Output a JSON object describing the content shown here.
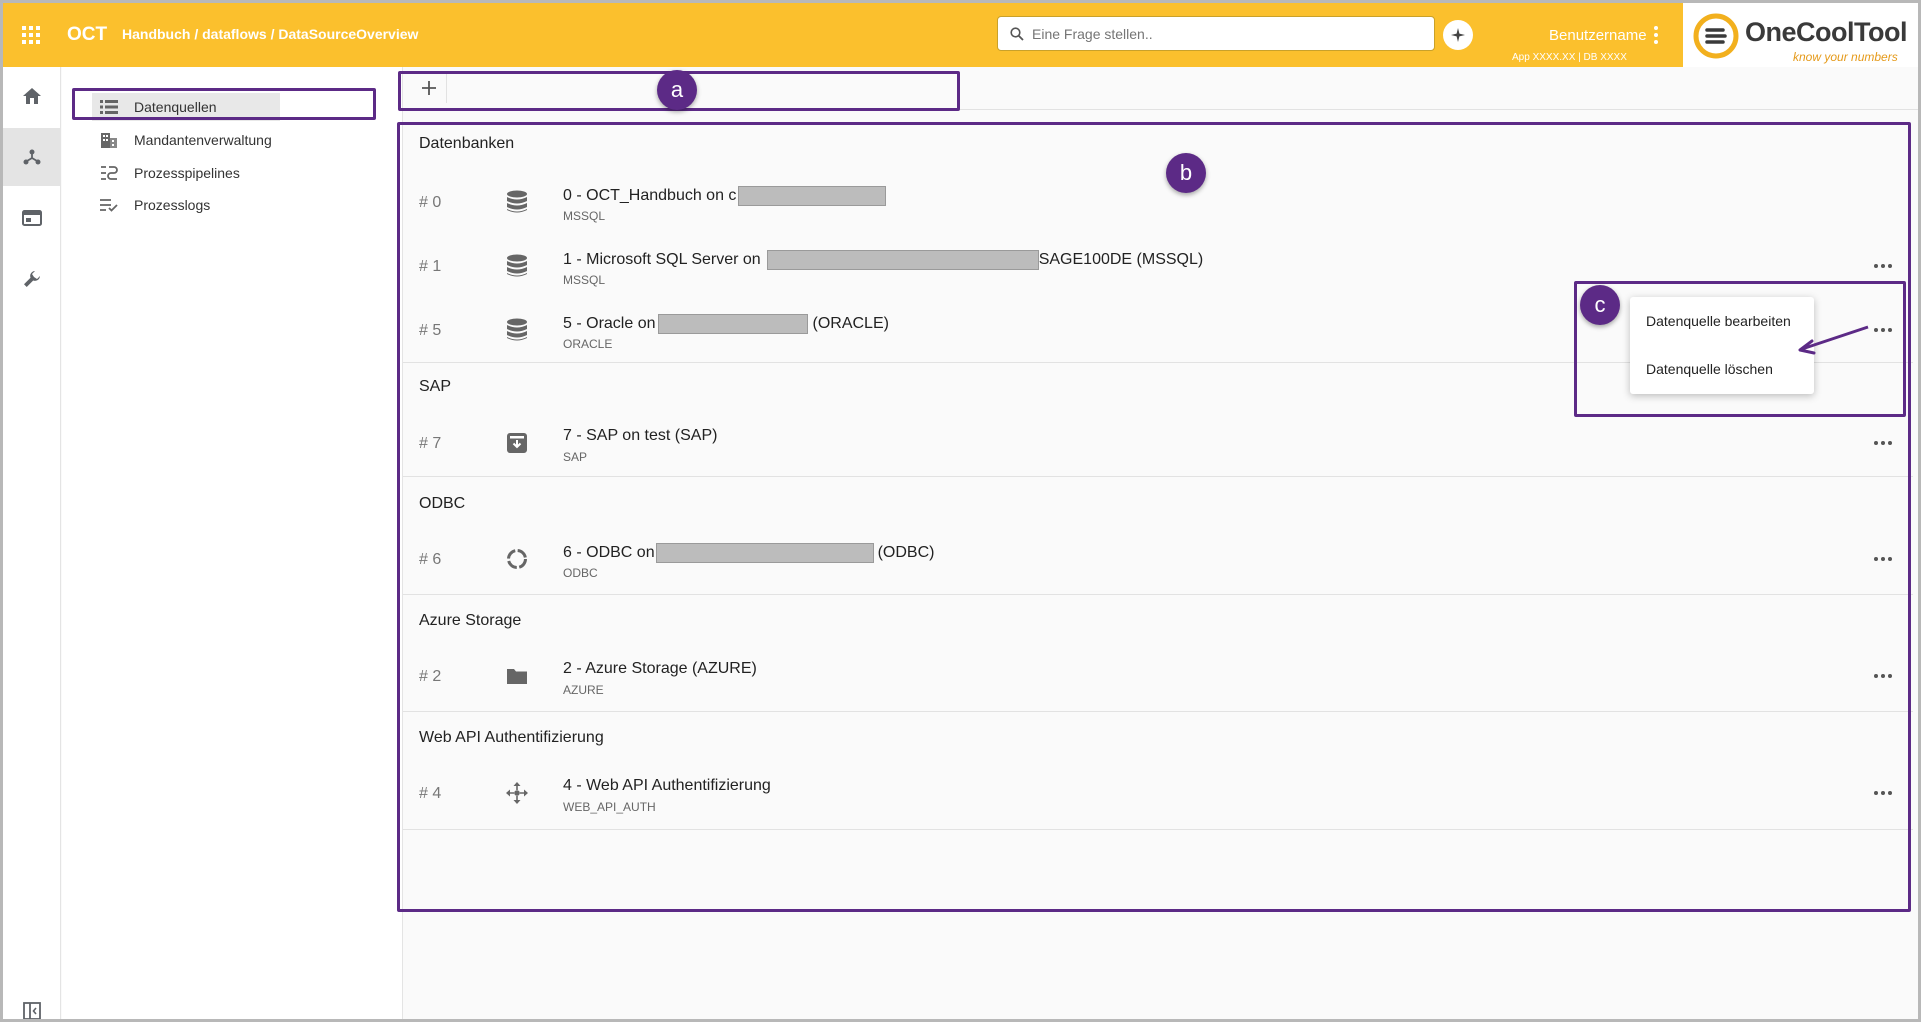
{
  "header": {
    "app_name": "OCT",
    "breadcrumb": "Handbuch / dataflows / DataSourceOverview",
    "search_placeholder": "Eine Frage stellen..",
    "username": "Benutzername",
    "app_version": "App XXXX.XX | DB XXXX",
    "logo_name": "OneCoolTool",
    "logo_tagline": "know your numbers",
    "color_accent": "#fbc02d"
  },
  "rail": {
    "items": [
      "home-icon",
      "dataflow-icon",
      "dashboard-icon",
      "tools-icon"
    ],
    "collapse_icon": "sidebar-collapse-icon"
  },
  "sidenav": {
    "items": [
      {
        "label": "Datenquellen",
        "icon": "list-icon"
      },
      {
        "label": "Mandantenverwaltung",
        "icon": "building-icon"
      },
      {
        "label": "Prozesspipelines",
        "icon": "pipeline-icon"
      },
      {
        "label": "Prozesslogs",
        "icon": "log-list-icon"
      }
    ]
  },
  "sections": [
    {
      "title": "Datenbanken",
      "rows": [
        {
          "num": "# 0",
          "title": "0 - OCT_Handbuch on c",
          "suffix": "",
          "type": "MSSQL",
          "icon": "database-icon"
        },
        {
          "num": "# 1",
          "title": "1 - Microsoft SQL Server on",
          "suffix": "SAGE100DE (MSSQL)",
          "type": "MSSQL",
          "icon": "database-icon"
        },
        {
          "num": "# 5",
          "title": "5 - Oracle on",
          "suffix": "(ORACLE)",
          "type": "ORACLE",
          "icon": "database-icon"
        }
      ]
    },
    {
      "title": "SAP",
      "rows": [
        {
          "num": "# 7",
          "title": "7 - SAP on test (SAP)",
          "suffix": "",
          "type": "SAP",
          "icon": "archive-icon"
        }
      ]
    },
    {
      "title": "ODBC",
      "rows": [
        {
          "num": "# 6",
          "title": "6 - ODBC on",
          "suffix": "(ODBC)",
          "type": "ODBC",
          "icon": "ring-icon"
        }
      ]
    },
    {
      "title": "Azure Storage",
      "rows": [
        {
          "num": "# 2",
          "title": "2 - Azure Storage (AZURE)",
          "suffix": "",
          "type": "AZURE",
          "icon": "folder-icon"
        }
      ]
    },
    {
      "title": "Web API Authentifizierung",
      "rows": [
        {
          "num": "# 4",
          "title": "4 - Web API Authentifizierung",
          "suffix": "",
          "type": "WEB_API_AUTH",
          "icon": "move-arrows-icon"
        }
      ]
    }
  ],
  "context_menu": {
    "edit": "Datenquelle bearbeiten",
    "delete": "Datenquelle löschen"
  },
  "annotations": {
    "a": "a",
    "b": "b",
    "c": "c",
    "color": "#5c2a86"
  }
}
